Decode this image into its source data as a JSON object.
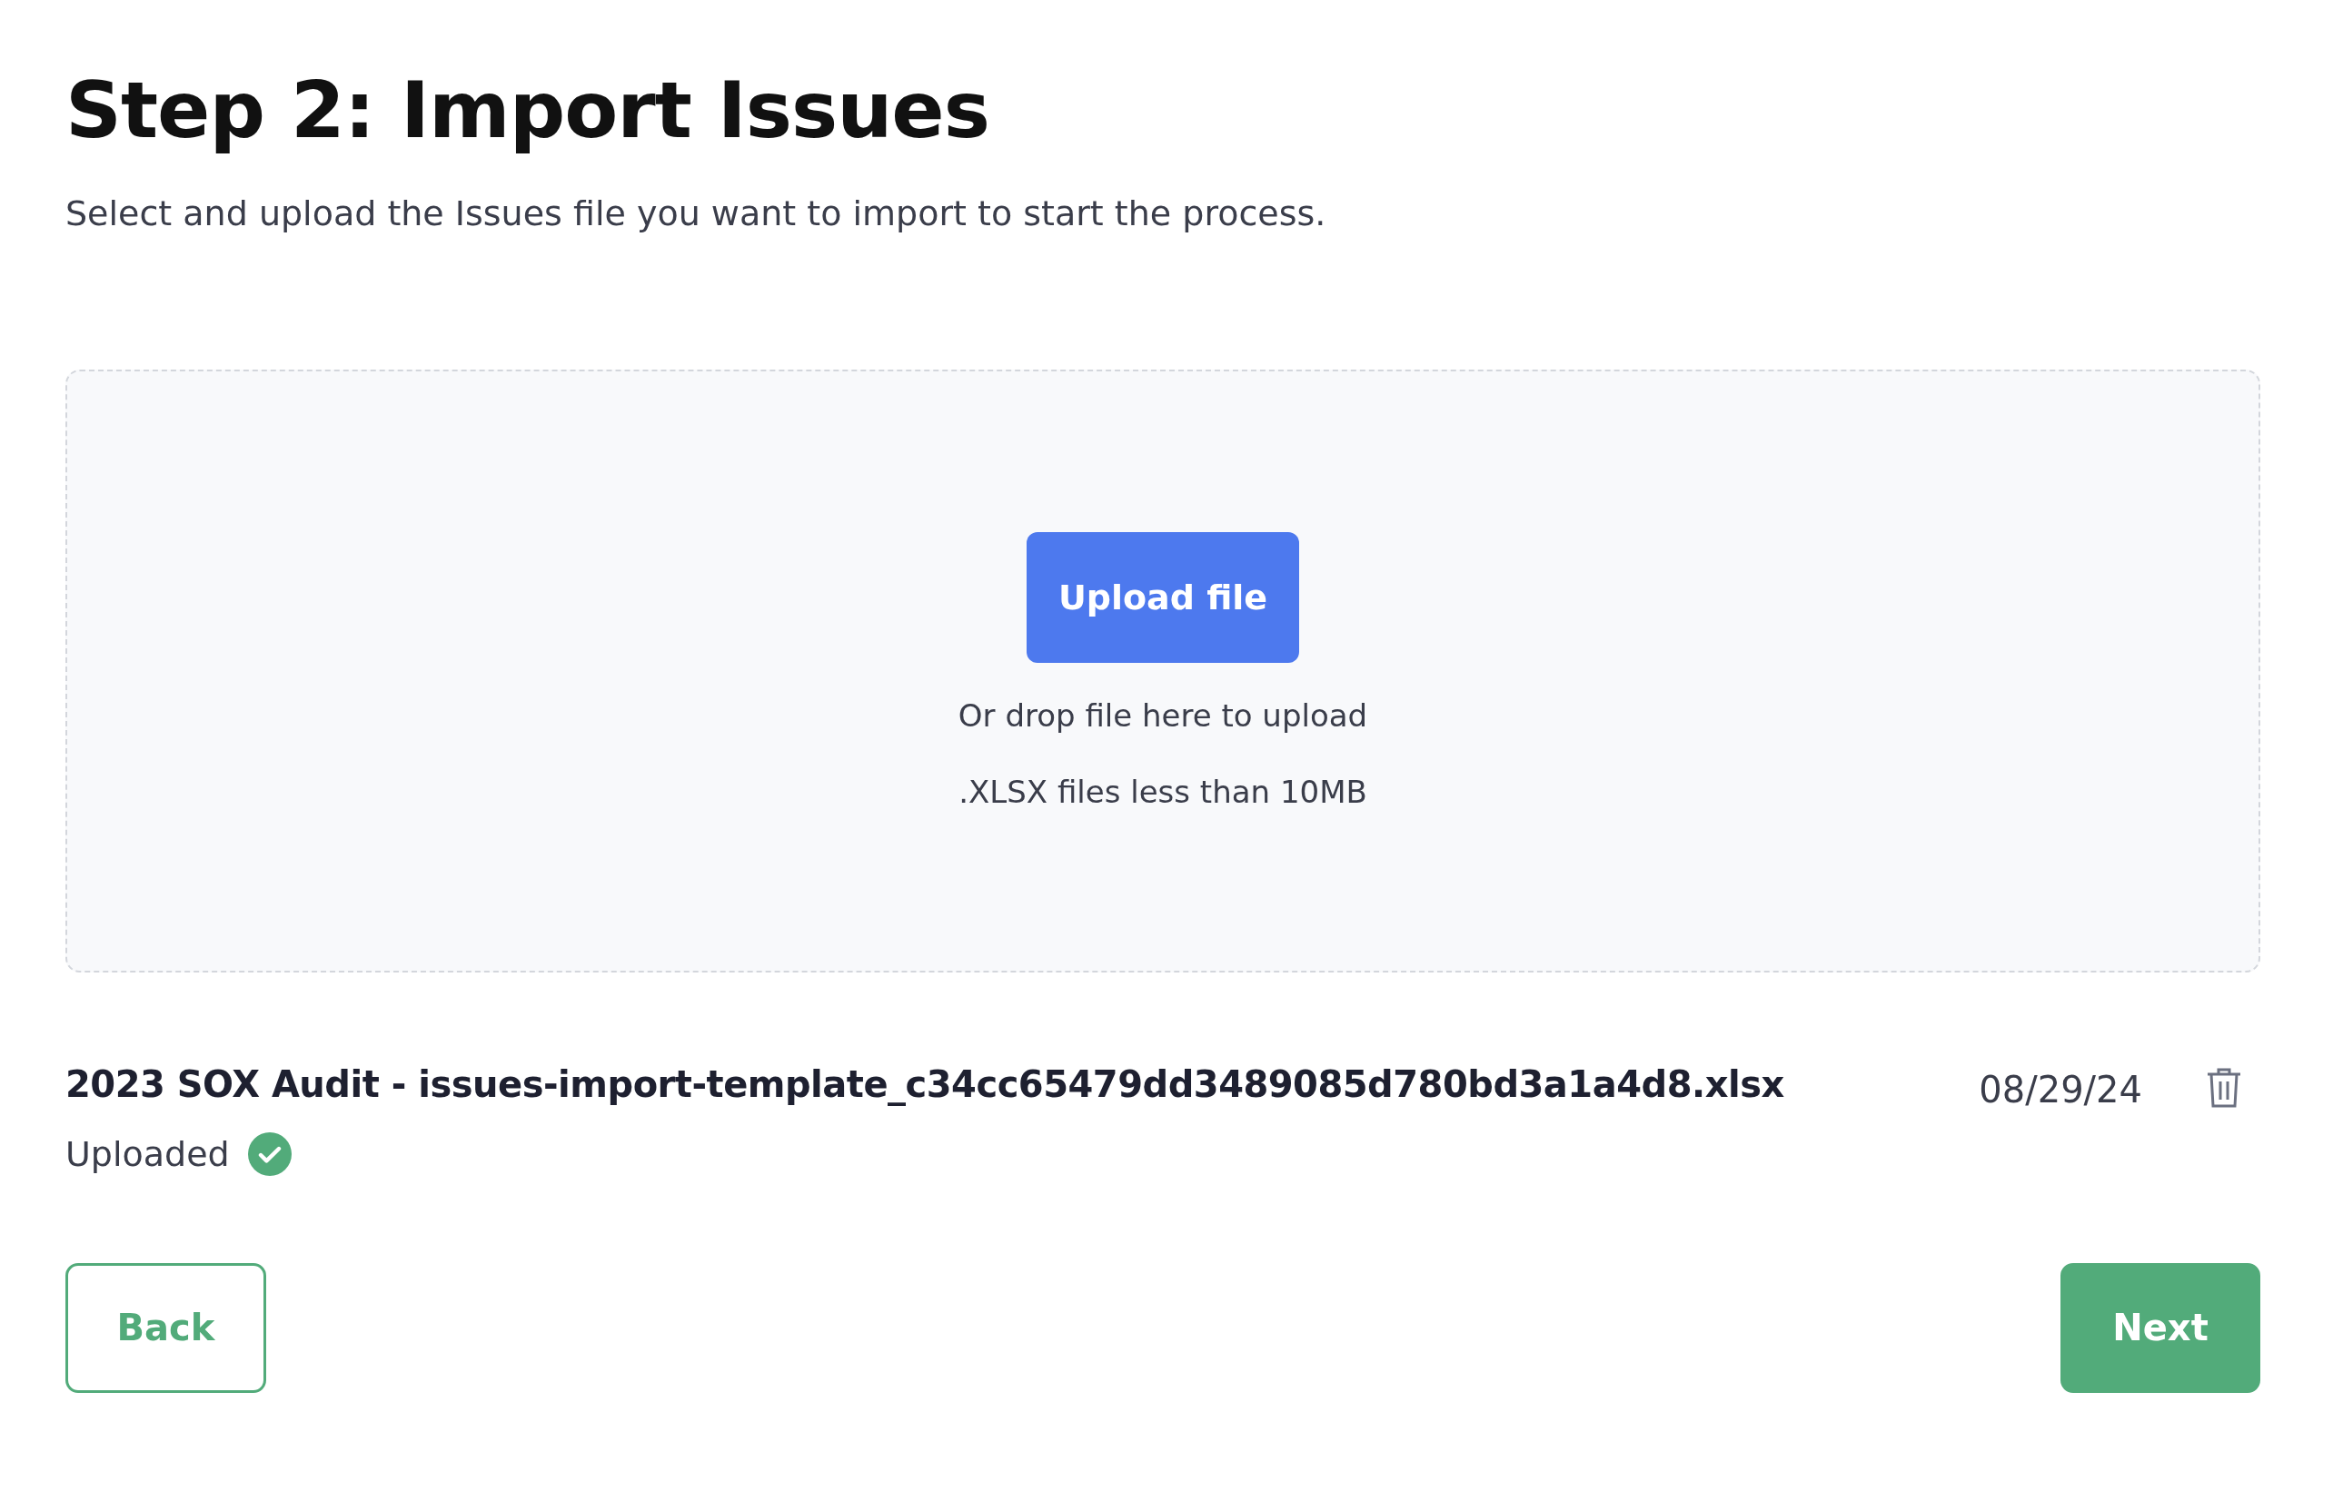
{
  "header": {
    "title": "Step 2: Import Issues",
    "subtitle": "Select and upload the Issues file you want to import to start the process."
  },
  "dropzone": {
    "button": "Upload file",
    "hint": "Or drop file here to upload",
    "limit": ".XLSX files less than 10MB"
  },
  "file": {
    "name": "2023 SOX Audit - issues-import-template_c34cc65479dd3489085d780bd3a1a4d8.xlsx",
    "date": "08/29/24",
    "status": "Uploaded",
    "complete": true
  },
  "footer": {
    "back": "Back",
    "next": "Next"
  }
}
